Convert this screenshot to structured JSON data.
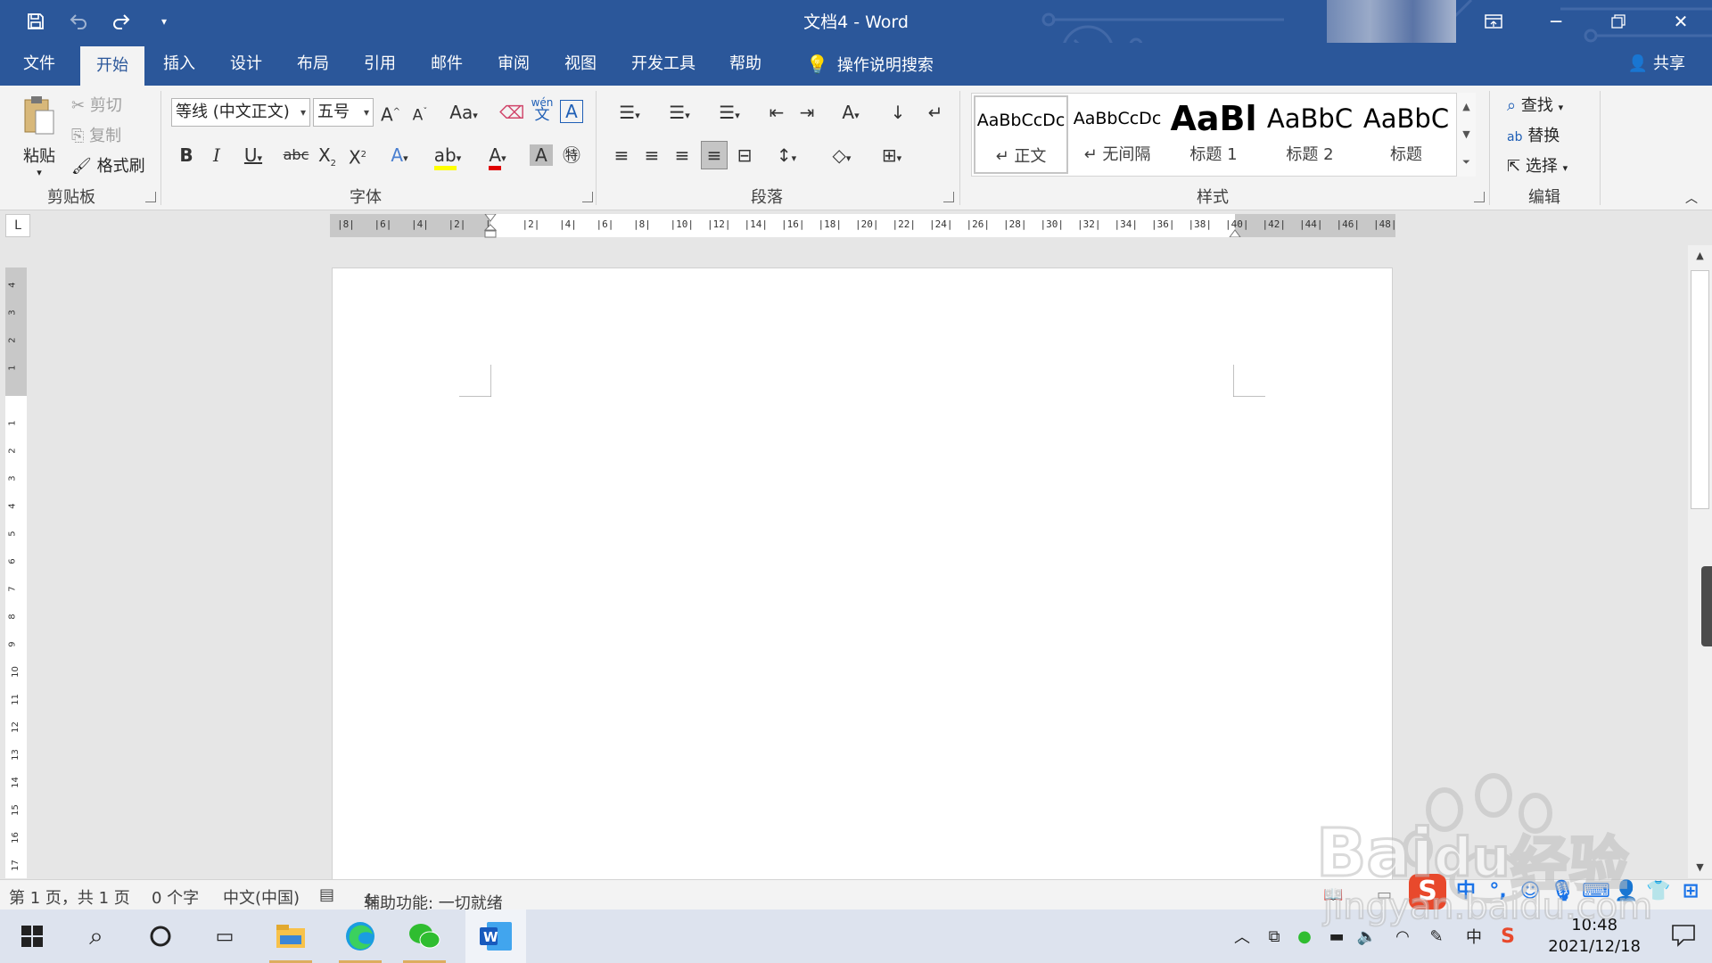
{
  "window": {
    "title": "文档4  -  Word"
  },
  "ribbon_tabs": [
    "文件",
    "开始",
    "插入",
    "设计",
    "布局",
    "引用",
    "邮件",
    "审阅",
    "视图",
    "开发工具",
    "帮助"
  ],
  "tell_me": "操作说明搜索",
  "share": "共享",
  "clipboard": {
    "paste": "粘贴",
    "cut": "剪切",
    "copy": "复制",
    "format_painter": "格式刷",
    "label": "剪贴板"
  },
  "font": {
    "name": "等线 (中文正文)",
    "size": "五号",
    "label": "字体",
    "phonetic_top": "wén",
    "phonetic_bottom": "文"
  },
  "paragraph": {
    "label": "段落"
  },
  "styles": {
    "label": "样式",
    "items": [
      {
        "sample": "AaBbCcDc",
        "name": "↵ 正文"
      },
      {
        "sample": "AaBbCcDc",
        "name": "↵ 无间隔"
      },
      {
        "sample": "AaBl",
        "name": "标题 1"
      },
      {
        "sample": "AaBbC",
        "name": "标题 2"
      },
      {
        "sample": "AaBbC",
        "name": "标题"
      }
    ]
  },
  "editing": {
    "find": "查找",
    "replace": "替换",
    "select": "选择",
    "label": "编辑"
  },
  "ruler": {
    "h_ticks": [
      "8",
      "6",
      "4",
      "2",
      "",
      "2",
      "4",
      "6",
      "8",
      "10",
      "12",
      "14",
      "16",
      "18",
      "20",
      "22",
      "24",
      "26",
      "28",
      "30",
      "32",
      "34",
      "36",
      "38",
      "40",
      "42",
      "44",
      "46",
      "48"
    ],
    "v_ticks": [
      "4",
      "3",
      "2",
      "1",
      "",
      "1",
      "2",
      "3",
      "4",
      "5",
      "6",
      "7",
      "8",
      "9",
      "10",
      "11",
      "12",
      "13",
      "14",
      "15",
      "16",
      "17"
    ]
  },
  "status": {
    "page": "第 1 页，共 1 页",
    "words": "0 个字",
    "language": "中文(中国)",
    "accessibility": "辅助功能: 一切就绪"
  },
  "ime": {
    "mode": "中",
    "punct": "°,"
  },
  "taskbar": {
    "time": "10:48",
    "date": "2021/12/18",
    "ime_indicator": "中"
  },
  "watermark": {
    "brand": "Bai",
    "brand2": "du",
    "text": "经验",
    "url": "jingyan.baidu.com"
  },
  "colors": {
    "accent": "#2b579a",
    "ribbon_bg": "#f3f3f3",
    "highlight_yellow": "#ffff00",
    "font_red": "#e00000"
  }
}
